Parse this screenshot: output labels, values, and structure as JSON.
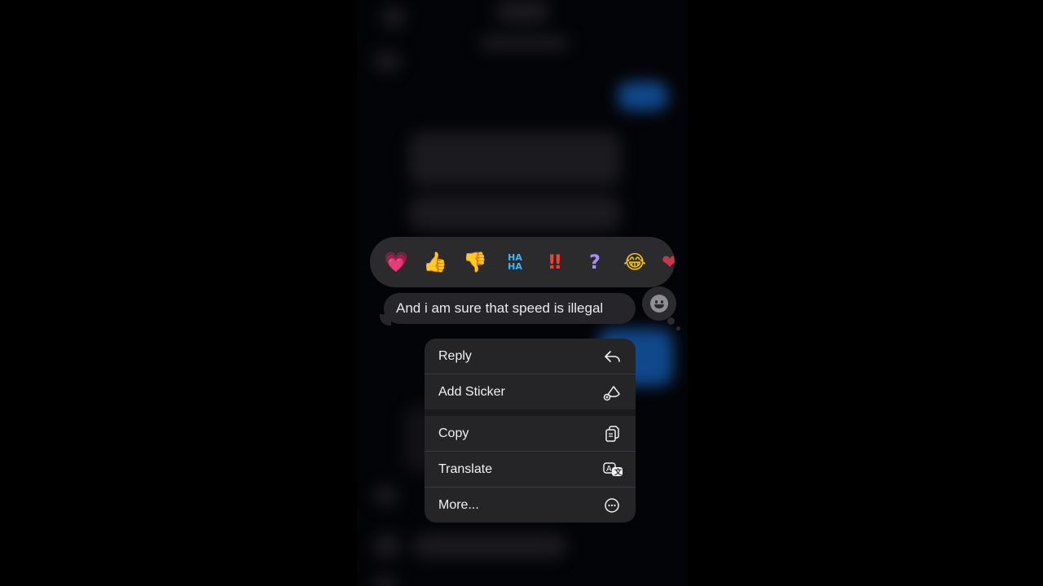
{
  "message": {
    "text": "And i am sure that speed is illegal"
  },
  "reactions": [
    {
      "icon": "pink-heart",
      "glyph": "💗"
    },
    {
      "icon": "thumbs-up",
      "glyph": "👍"
    },
    {
      "icon": "thumbs-down",
      "glyph": "👎"
    },
    {
      "icon": "haha",
      "glyph": "HA HA"
    },
    {
      "icon": "double-exclamation",
      "glyph": "‼"
    },
    {
      "icon": "question-mark",
      "glyph": "?"
    },
    {
      "icon": "laughing-face",
      "glyph": "😂"
    },
    {
      "icon": "more-reactions",
      "glyph": "❤"
    }
  ],
  "menu": {
    "items": [
      {
        "label": "Reply",
        "icon": "reply-arrow-icon"
      },
      {
        "label": "Add Sticker",
        "icon": "sticker-icon"
      },
      {
        "label": "Copy",
        "icon": "copy-icon"
      },
      {
        "label": "Translate",
        "icon": "translate-icon"
      },
      {
        "label": "More...",
        "icon": "ellipsis-circle-icon"
      }
    ]
  },
  "colors": {
    "background": "#000000",
    "menu": "#252528",
    "bubble": "#26262a",
    "accent_blue": "#1a6fd6"
  }
}
